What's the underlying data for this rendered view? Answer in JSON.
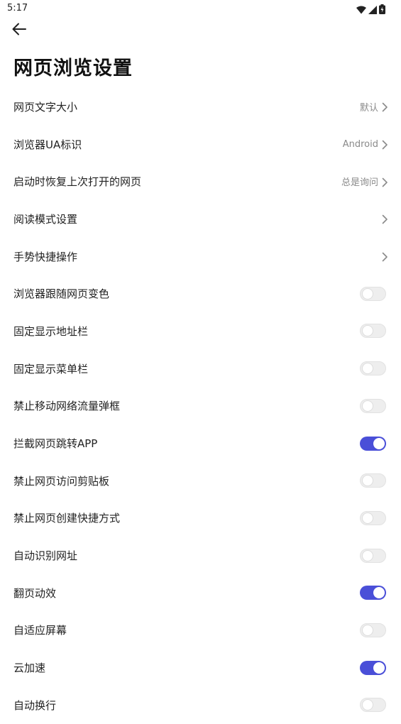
{
  "status_bar": {
    "time": "5:17"
  },
  "header": {
    "back_icon": "arrow-left-icon",
    "title": "网页浏览设置"
  },
  "colors": {
    "accent": "#4a4fd8",
    "toggle_off": "#eeeeee",
    "value_text": "#8a8a8a"
  },
  "settings": [
    {
      "id": "font-size",
      "label": "网页文字大小",
      "type": "link",
      "value": "默认"
    },
    {
      "id": "ua",
      "label": "浏览器UA标识",
      "type": "link",
      "value": "Android"
    },
    {
      "id": "restore",
      "label": "启动时恢复上次打开的网页",
      "type": "link",
      "value": "总是询问"
    },
    {
      "id": "reader-mode",
      "label": "阅读模式设置",
      "type": "link",
      "value": ""
    },
    {
      "id": "gestures",
      "label": "手势快捷操作",
      "type": "link",
      "value": ""
    },
    {
      "id": "follow-color",
      "label": "浏览器跟随网页变色",
      "type": "toggle",
      "on": false
    },
    {
      "id": "fixed-address-bar",
      "label": "固定显示地址栏",
      "type": "toggle",
      "on": false
    },
    {
      "id": "fixed-menu-bar",
      "label": "固定显示菜单栏",
      "type": "toggle",
      "on": false
    },
    {
      "id": "mobile-data-popup",
      "label": "禁止移动网络流量弹框",
      "type": "toggle",
      "on": false
    },
    {
      "id": "block-app-redirect",
      "label": "拦截网页跳转APP",
      "type": "toggle",
      "on": true
    },
    {
      "id": "clipboard",
      "label": "禁止网页访问剪贴板",
      "type": "toggle",
      "on": false
    },
    {
      "id": "shortcut",
      "label": "禁止网页创建快捷方式",
      "type": "toggle",
      "on": false
    },
    {
      "id": "auto-url",
      "label": "自动识别网址",
      "type": "toggle",
      "on": false
    },
    {
      "id": "page-flip",
      "label": "翻页动效",
      "type": "toggle",
      "on": true
    },
    {
      "id": "fit-screen",
      "label": "自适应屏幕",
      "type": "toggle",
      "on": false
    },
    {
      "id": "cloud-accel",
      "label": "云加速",
      "type": "toggle",
      "on": true
    },
    {
      "id": "word-wrap",
      "label": "自动换行",
      "type": "toggle",
      "on": false
    }
  ]
}
